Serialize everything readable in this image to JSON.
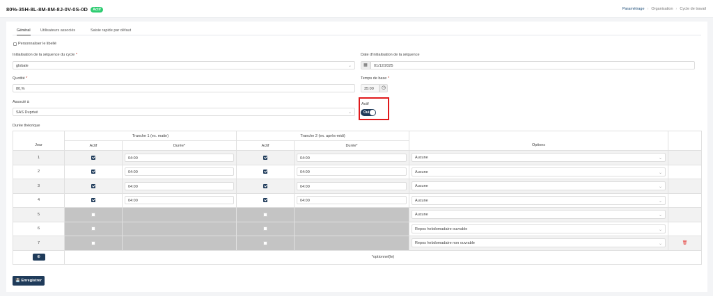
{
  "header": {
    "title": "80%-35H-8L-8M-8M-8J-0V-0S-0D",
    "badge": "Actif",
    "breadcrumb": [
      "Paramétrage",
      "Organisation",
      "Cycle de travail"
    ]
  },
  "tabs": [
    "Général",
    "Utilisateurs associés",
    "Saisie rapide par défaut"
  ],
  "form": {
    "customize_label": "Personnaliser le libellé",
    "init_sequence_label": "Initialisation de la séquence du cycle",
    "init_sequence_value": "globale",
    "init_date_label": "Date d'initialisation de la séquence",
    "init_date_value": "01/12/2025",
    "quotite_label": "Quotité",
    "quotite_value": "80,%",
    "temps_base_label": "Temps de base",
    "temps_base_value": "35:00",
    "associe_label": "Associé à",
    "associe_value": "SAS Duprivé",
    "actif_label": "Actif",
    "actif_toggle": "Oui",
    "required_mark": "*"
  },
  "table": {
    "section_label": "Durée théorique",
    "col_jour": "Jour",
    "tranche1": "Tranche 1 (ex. matin)",
    "tranche2": "Tranche 2 (ex. après-midi)",
    "col_actif": "Actif",
    "col_duree": "Durée*",
    "col_options": "Options",
    "footer_note": "*optionnel(le)",
    "rows": [
      {
        "day": "1",
        "t1": "04:00",
        "t2": "04:00",
        "option": "Aucune"
      },
      {
        "day": "2",
        "t1": "04:00",
        "t2": "04:00",
        "option": "Aucune"
      },
      {
        "day": "3",
        "t1": "04:00",
        "t2": "04:00",
        "option": "Aucune"
      },
      {
        "day": "4",
        "t1": "04:00",
        "t2": "04:00",
        "option": "Aucune"
      },
      {
        "day": "5",
        "t1": "",
        "t2": "",
        "option": "Aucune"
      },
      {
        "day": "6",
        "t1": "",
        "t2": "",
        "option": "Repos hebdomadaire ouvrable"
      },
      {
        "day": "7",
        "t1": "",
        "t2": "",
        "option": "Repos hebdomadaire non ouvrable"
      }
    ]
  },
  "actions": {
    "save_label": "Enregistrer"
  }
}
